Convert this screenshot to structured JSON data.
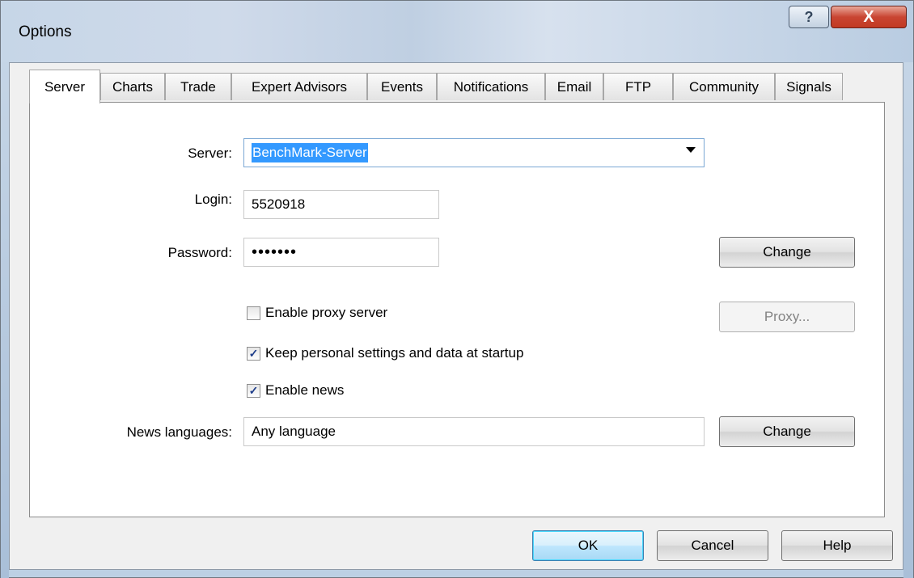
{
  "window": {
    "title": "Options"
  },
  "titlebar": {
    "help_glyph": "?",
    "close_glyph": "X"
  },
  "tabs": [
    {
      "label": "Server"
    },
    {
      "label": "Charts"
    },
    {
      "label": "Trade"
    },
    {
      "label": "Expert Advisors"
    },
    {
      "label": "Events"
    },
    {
      "label": "Notifications"
    },
    {
      "label": "Email"
    },
    {
      "label": "FTP"
    },
    {
      "label": "Community"
    },
    {
      "label": "Signals"
    }
  ],
  "server": {
    "server_label": "Server:",
    "server_value": "BenchMark-Server",
    "login_label": "Login:",
    "login_value": "5520918",
    "password_label": "Password:",
    "password_value": "•••••••",
    "change_password_label": "Change",
    "proxy_label": "Enable proxy server",
    "proxy_checked": false,
    "proxy_button_label": "Proxy...",
    "keep_settings_label": "Keep personal settings and data at startup",
    "keep_settings_checked": true,
    "news_label": "Enable news",
    "news_checked": true,
    "news_lang_label": "News languages:",
    "news_lang_value": "Any language",
    "change_lang_label": "Change"
  },
  "footer": {
    "ok_label": "OK",
    "cancel_label": "Cancel",
    "help_label": "Help"
  },
  "check_glyph": "✓"
}
